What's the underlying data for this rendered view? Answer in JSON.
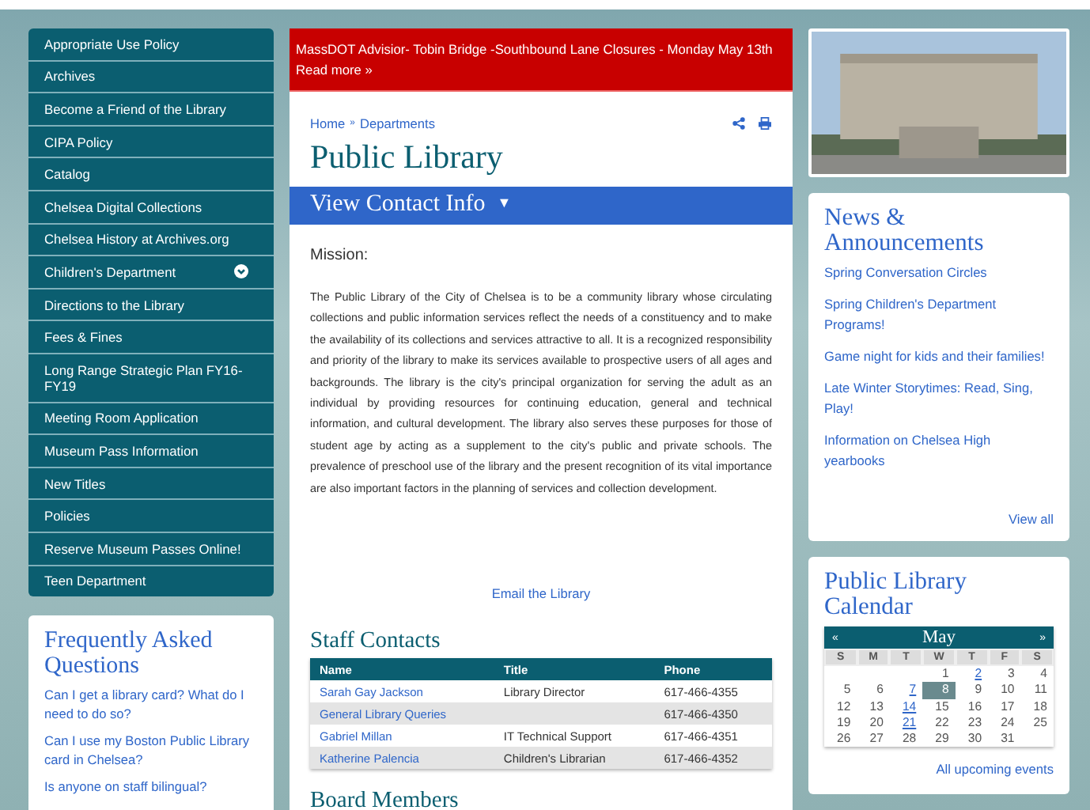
{
  "menu": [
    {
      "label": "Appropriate Use Policy",
      "kind": "link"
    },
    {
      "label": "Archives",
      "kind": "link"
    },
    {
      "label": "Become a Friend of the Library",
      "kind": "link"
    },
    {
      "label": "CIPA Policy",
      "kind": "link"
    },
    {
      "label": "Catalog",
      "kind": "link"
    },
    {
      "label": "Chelsea Digital Collections",
      "kind": "link"
    },
    {
      "label": "Chelsea History at Archives.org",
      "kind": "link"
    },
    {
      "label": "Children's Department",
      "kind": "submenu"
    },
    {
      "label": "Directions to the Library",
      "kind": "link"
    },
    {
      "label": "Fees & Fines",
      "kind": "link"
    },
    {
      "label": "Long Range Strategic Plan FY16-FY19",
      "kind": "link"
    },
    {
      "label": "Meeting Room Application",
      "kind": "link"
    },
    {
      "label": "Museum Pass Information",
      "kind": "link"
    },
    {
      "label": "New Titles",
      "kind": "link"
    },
    {
      "label": "Policies",
      "kind": "link"
    },
    {
      "label": "Reserve Museum Passes Online!",
      "kind": "link"
    },
    {
      "label": "Teen Department",
      "kind": "link"
    }
  ],
  "faq": {
    "title": "Frequently Asked Questions",
    "items": [
      "Can I get a library card? What do I need to do so?",
      "Can I use my Boston Public Library card in Chelsea?",
      "Is anyone on staff bilingual?"
    ]
  },
  "alert": {
    "text": "MassDOT Advisior- Tobin Bridge -Southbound Lane Closures - Monday May 13th",
    "link": "Read more »"
  },
  "breadcrumb": [
    "Home",
    "Departments"
  ],
  "breadcrumb_separator": "»",
  "page_title": "Public Library",
  "contact_bar": {
    "label": "View Contact Info",
    "caret": "▼"
  },
  "mission": {
    "heading": "Mission:",
    "text": "The Public Library of the City of Chelsea is to be a community library whose circulating collections and public information services reflect the needs of a constituency and to make the availability of its collections and services attractive to all. It is a recognized responsibility and priority of the library to make its services available to prospective users of all ages and backgrounds. The library is the city's principal organization for serving the adult as an individual by providing resources for continuing education, general and technical information, and cultural development. The library also serves these purposes for those of student age by acting as a supplement to the city's public and private schools. The prevalence of preschool use of the library and the present recognition of its vital importance are also important factors in the planning of services and collection development."
  },
  "email_link": "Email the Library",
  "staff": {
    "title": "Staff Contacts",
    "columns": [
      "Name",
      "Title",
      "Phone"
    ],
    "rows": [
      [
        "Sarah Gay Jackson",
        "Library Director",
        "617-466-4355"
      ],
      [
        "General Library Queries",
        "",
        "617-466-4350"
      ],
      [
        "Gabriel Millan",
        "IT Technical Support",
        "617-466-4351"
      ],
      [
        "Katherine Palencia",
        "Children's Librarian",
        "617-466-4352"
      ]
    ]
  },
  "next_heading": "Board Members",
  "news": {
    "title": "News & Announcements",
    "items": [
      "Spring Conversation Circles",
      "Spring Children's Department Programs!",
      "Game night for kids and their families!",
      "Late Winter Storytimes: Read, Sing, Play!",
      "Information on Chelsea High yearbooks"
    ],
    "view_all": "View all"
  },
  "calendar": {
    "title": "Public Library Calendar",
    "month": "May",
    "prev": "«",
    "next": "»",
    "weekdays": [
      "S",
      "M",
      "T",
      "W",
      "T",
      "F",
      "S"
    ],
    "weeks": [
      [
        {
          "kind": "blank"
        },
        {
          "kind": "blank"
        },
        {
          "kind": "blank"
        },
        {
          "kind": "day",
          "day": "1",
          "link": false,
          "selected": false
        },
        {
          "day": "2",
          "link": true,
          "selected": false
        },
        {
          "day": "3",
          "link": false,
          "selected": false
        },
        {
          "day": "4",
          "link": false,
          "selected": false
        }
      ],
      [
        {
          "day": "5",
          "link": false,
          "selected": false
        },
        {
          "day": "6",
          "link": false,
          "selected": false
        },
        {
          "day": "7",
          "link": true,
          "selected": false
        },
        {
          "day": "8",
          "link": false,
          "selected": true
        },
        {
          "day": "9",
          "link": false,
          "selected": false
        },
        {
          "day": "10",
          "link": false,
          "selected": false
        },
        {
          "day": "11",
          "link": false,
          "selected": false
        }
      ],
      [
        {
          "day": "12",
          "link": false,
          "selected": false
        },
        {
          "day": "13",
          "link": false,
          "selected": false
        },
        {
          "day": "14",
          "link": true,
          "selected": false
        },
        {
          "day": "15",
          "link": false,
          "selected": false
        },
        {
          "day": "16",
          "link": false,
          "selected": false
        },
        {
          "day": "17",
          "link": false,
          "selected": false
        },
        {
          "day": "18",
          "link": false,
          "selected": false
        }
      ],
      [
        {
          "day": "19",
          "link": false,
          "selected": false
        },
        {
          "day": "20",
          "link": false,
          "selected": false
        },
        {
          "day": "21",
          "link": true,
          "selected": false
        },
        {
          "day": "22",
          "link": false,
          "selected": false
        },
        {
          "day": "23",
          "link": false,
          "selected": false
        },
        {
          "day": "24",
          "link": false,
          "selected": false
        },
        {
          "day": "25",
          "link": false,
          "selected": false
        }
      ],
      [
        {
          "day": "26",
          "link": false,
          "selected": false
        },
        {
          "day": "27",
          "link": false,
          "selected": false
        },
        {
          "day": "28",
          "link": false,
          "selected": false
        },
        {
          "day": "29",
          "link": false,
          "selected": false
        },
        {
          "day": "30",
          "link": false,
          "selected": false
        },
        {
          "day": "31",
          "link": false,
          "selected": false
        },
        {
          "kind": "blank"
        }
      ]
    ],
    "all_events": "All upcoming events"
  }
}
